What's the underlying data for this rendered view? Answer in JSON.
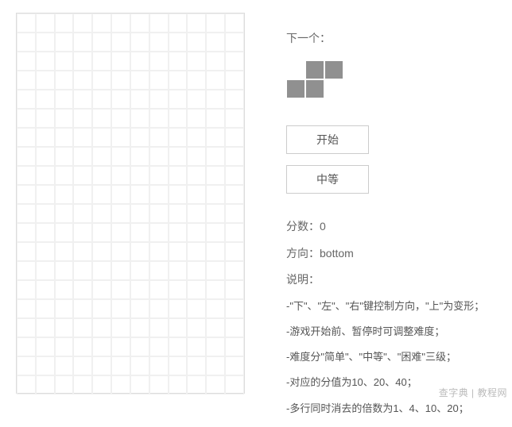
{
  "next": {
    "label": "下一个：",
    "piece": "s"
  },
  "buttons": {
    "start": "开始",
    "difficulty": "中等"
  },
  "info": {
    "score_label": "分数：",
    "score_value": "0",
    "direction_label": "方向：",
    "direction_value": "bottom",
    "desc_label": "说明："
  },
  "rules": [
    "-\"下\"、\"左\"、\"右\"键控制方向，\"上\"为变形；",
    "-游戏开始前、暂停时可调整难度；",
    "-难度分\"简单\"、\"中等\"、\"困难\"三级；",
    "-对应的分值为10、20、40；",
    "-多行同时消去的倍数为1、4、10、20；"
  ],
  "board": {
    "cols": 12,
    "rows": 20
  },
  "watermark": "查字典 | 教程网"
}
